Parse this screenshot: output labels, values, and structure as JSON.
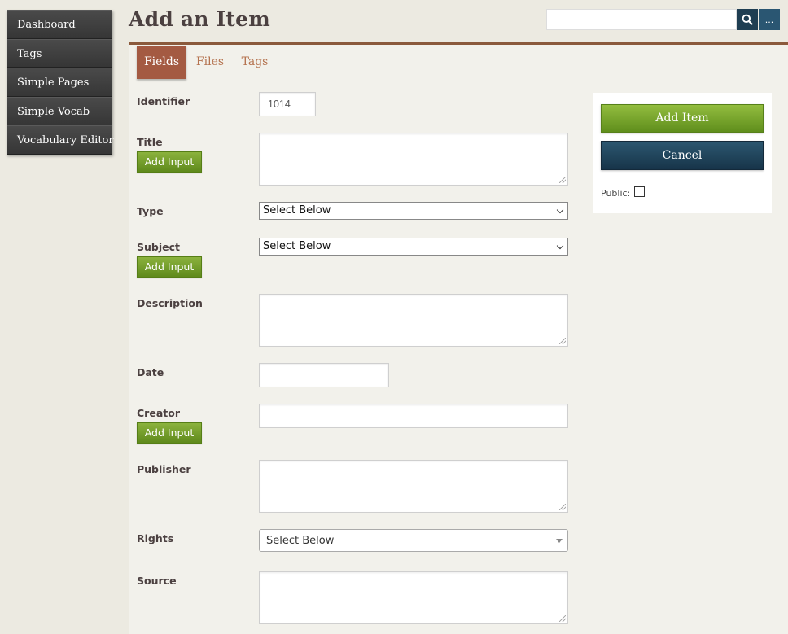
{
  "sidebar": {
    "items": [
      {
        "label": "Dashboard"
      },
      {
        "label": "Tags"
      },
      {
        "label": "Simple Pages"
      },
      {
        "label": "Simple Vocab"
      },
      {
        "label": "Vocabulary Editor"
      }
    ]
  },
  "header": {
    "title": "Add an Item",
    "search": {
      "value": "",
      "placeholder": ""
    },
    "more_label": "..."
  },
  "tabs": [
    {
      "label": "Fields",
      "active": true
    },
    {
      "label": "Files",
      "active": false
    },
    {
      "label": "Tags",
      "active": false
    }
  ],
  "fields": {
    "identifier": {
      "label": "Identifier",
      "value": "1014"
    },
    "title": {
      "label": "Title",
      "add_input_label": "Add Input",
      "value": ""
    },
    "type": {
      "label": "Type",
      "selected": "Select Below"
    },
    "subject": {
      "label": "Subject",
      "selected": "Select Below",
      "add_input_label": "Add Input"
    },
    "description": {
      "label": "Description",
      "value": ""
    },
    "date": {
      "label": "Date",
      "value": ""
    },
    "creator": {
      "label": "Creator",
      "value": "",
      "add_input_label": "Add Input"
    },
    "publisher": {
      "label": "Publisher",
      "value": ""
    },
    "rights": {
      "label": "Rights",
      "selected": "Select Below"
    },
    "source": {
      "label": "Source",
      "value": ""
    }
  },
  "save_panel": {
    "add_item_label": "Add Item",
    "cancel_label": "Cancel",
    "public_label": "Public:",
    "public_checked": false
  },
  "colors": {
    "accent_brown": "#a45a42",
    "green_button": "#6f9b26",
    "navy_button": "#1f3e52",
    "sidebar_bg": "#3d3d3d"
  }
}
